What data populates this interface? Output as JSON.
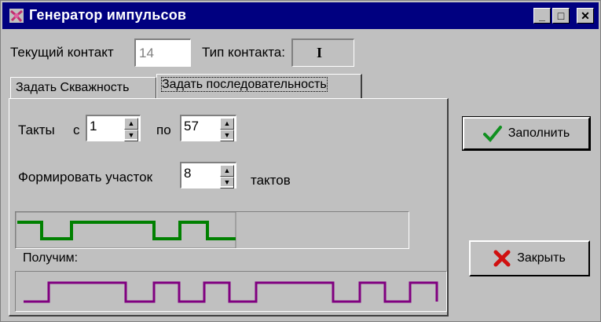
{
  "window": {
    "title": "Генератор импульсов",
    "controls": {
      "minimize": "_",
      "maximize": "□",
      "close": "✕"
    }
  },
  "header": {
    "current_contact_label": "Текущий контакт",
    "current_contact_value": "14",
    "contact_type_label": "Тип контакта:",
    "contact_type_value": "I"
  },
  "tabs": [
    {
      "label": "Задать Скважность",
      "active": false
    },
    {
      "label": "Задать последовательность",
      "active": true
    }
  ],
  "sequence": {
    "cycles_label": "Такты",
    "from_label": "с",
    "from_value": "1",
    "to_label": "по",
    "to_value": "57",
    "segment_label": "Формировать участок",
    "segment_value": "8",
    "segment_unit": "тактов",
    "result_label": "Получим:",
    "pattern_color": "#008000",
    "result_color": "#800080"
  },
  "buttons": {
    "fill": "Заполнить",
    "close": "Закрыть"
  },
  "icons": {
    "app": "app-icon",
    "fill": "checkmark-icon",
    "close": "red-x-icon"
  }
}
